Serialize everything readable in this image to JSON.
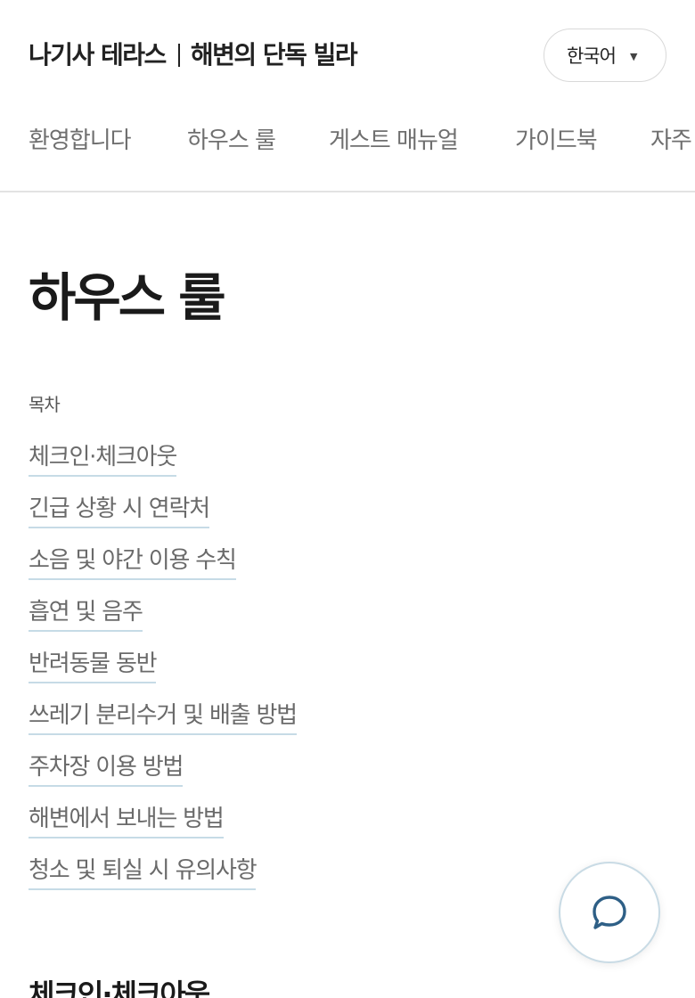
{
  "header": {
    "brand_name": "나기사 테라스",
    "brand_tagline": "해변의 단독 빌라",
    "language": {
      "selected": "한국어",
      "caret": "▼"
    }
  },
  "tabs": [
    {
      "label": "환영합니다"
    },
    {
      "label": "하우스 룰"
    },
    {
      "label": "게스트 매뉴얼"
    },
    {
      "label": "가이드북"
    },
    {
      "label": "자주"
    }
  ],
  "main": {
    "title": "하우스 룰",
    "toc_label": "목차",
    "toc": [
      {
        "label": "체크인·체크아웃"
      },
      {
        "label": "긴급 상황 시 연락처"
      },
      {
        "label": "소음 및 야간 이용 수칙"
      },
      {
        "label": "흡연 및 음주"
      },
      {
        "label": "반려동물 동반"
      },
      {
        "label": "쓰레기 분리수거 및 배출 방법"
      },
      {
        "label": "주차장 이용 방법"
      },
      {
        "label": "해변에서 보내는 방법"
      },
      {
        "label": "청소 및 퇴실 시 유의사항"
      }
    ],
    "section_heading": "체크인·체크아웃"
  },
  "chat": {
    "icon": "chat-bubble-icon",
    "color": "#2e5f86"
  }
}
